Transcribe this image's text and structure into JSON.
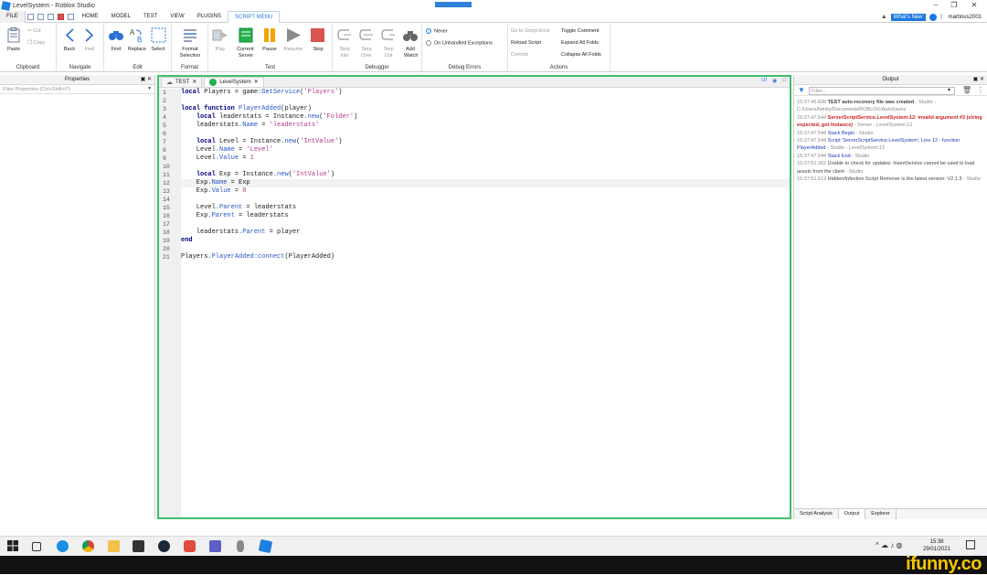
{
  "window": {
    "title": "LevelSystem - Roblox Studio"
  },
  "menu": {
    "tabs": [
      "FILE",
      "HOME",
      "MODEL",
      "TEST",
      "VIEW",
      "PLUGINS",
      "SCRIPT MENU"
    ],
    "whats_new": "What's New",
    "username": "martinus2001"
  },
  "ribbon": {
    "clipboard": {
      "label": "Clipboard",
      "paste": "Paste",
      "cut": "Cut",
      "copy": "Copy"
    },
    "navigate": {
      "label": "Navigate",
      "back": "Back",
      "fwd": "Fwd"
    },
    "edit": {
      "label": "Edit",
      "find": "Find",
      "replace": "Replace",
      "select": "Select"
    },
    "format": {
      "label": "Format",
      "format_selection": "Format Selection"
    },
    "test": {
      "label": "Test",
      "play": "Play",
      "current_server": "Current: Server",
      "pause": "Pause",
      "resume": "Resume",
      "stop": "Stop"
    },
    "debugger": {
      "label": "Debugger",
      "step_into": "Step Into",
      "step_over": "Step Over",
      "step_out": "Step Out",
      "add_watch": "Add Watch"
    },
    "debug_errors": {
      "label": "Debug Errors",
      "never": "Never",
      "on_unhandled": "On Unhandled Exceptions"
    },
    "actions": {
      "label": "Actions",
      "go_to_error": "Go to Script Error",
      "reload": "Reload Script",
      "commit": "Commit",
      "toggle_comment": "Toggle Comment",
      "expand_folds": "Expand All Folds",
      "collapse_folds": "Collapse All Folds"
    }
  },
  "properties": {
    "title": "Properties",
    "filter_placeholder": "Filter Properties (Ctrl+Shift+P)"
  },
  "editor": {
    "tabs": [
      {
        "label": "TEST"
      },
      {
        "label": "LevelSystem"
      }
    ],
    "ui_toggle": "UI",
    "current_line": 12,
    "lines": [
      "local Players = game:GetService('Players')",
      "",
      "local function PlayerAdded(player)",
      "\tlocal leaderstats = Instance.new('Folder')",
      "\tleaderstats.Name = 'leaderstats'",
      "",
      "\tlocal Level = Instance.new('IntValue')",
      "\tLevel.Name = 'Level'",
      "\tLevel.Value = 1",
      "",
      "\tlocal Exp = Instance.new('IntValue')",
      "\tExp.Name = Exp",
      "\tExp.Value = 0",
      "",
      "\tLevel.Parent = leaderstats",
      "\tExp.Parent = leaderstats",
      "",
      "\tleaderstats.Parent = player",
      "end",
      "",
      "Players.PlayerAdded:connect(PlayerAdded)"
    ]
  },
  "output": {
    "title": "Output",
    "filter_placeholder": "Filter...",
    "lines": [
      {
        "ts": "15:37:46.838",
        "text": "TEST auto-recovery file was created",
        "style": "b",
        "src": " - Studio - C:/Users/family/Documents/ROBLOX/AutoSaves"
      },
      {
        "ts": "15:37:47.544",
        "text": "ServerScriptService.LevelSystem:12: invalid argument #3 (string expected, got Instance)",
        "style": "red",
        "src": " - Server - LevelSystem:12"
      },
      {
        "ts": "15:37:47.544",
        "text": "Stack Begin",
        "style": "blue",
        "src": " - Studio"
      },
      {
        "ts": "15:37:47.544",
        "text": "Script 'ServerScriptService.LevelSystem', Line 12 - function PlayerAdded",
        "style": "blue",
        "src": " - Studio - LevelSystem:12"
      },
      {
        "ts": "15:37:47.544",
        "text": "Stack End",
        "style": "blue",
        "src": " - Studio"
      },
      {
        "ts": "15:37:51.362",
        "text": "Unable to check for updates: InsertService cannot be used to load assets from the client",
        "style": "",
        "src": " - Studio"
      },
      {
        "ts": "15:37:51.513",
        "text": "Hidden/Infection Script Remover is the latest version: V2.1.3",
        "style": "",
        "src": " - Studio"
      }
    ],
    "tabs": [
      "Script Analysis",
      "Output",
      "Explorer"
    ]
  },
  "taskbar": {
    "time": "15:38",
    "date": "29/01/2021"
  },
  "watermark": "ifunny.co"
}
